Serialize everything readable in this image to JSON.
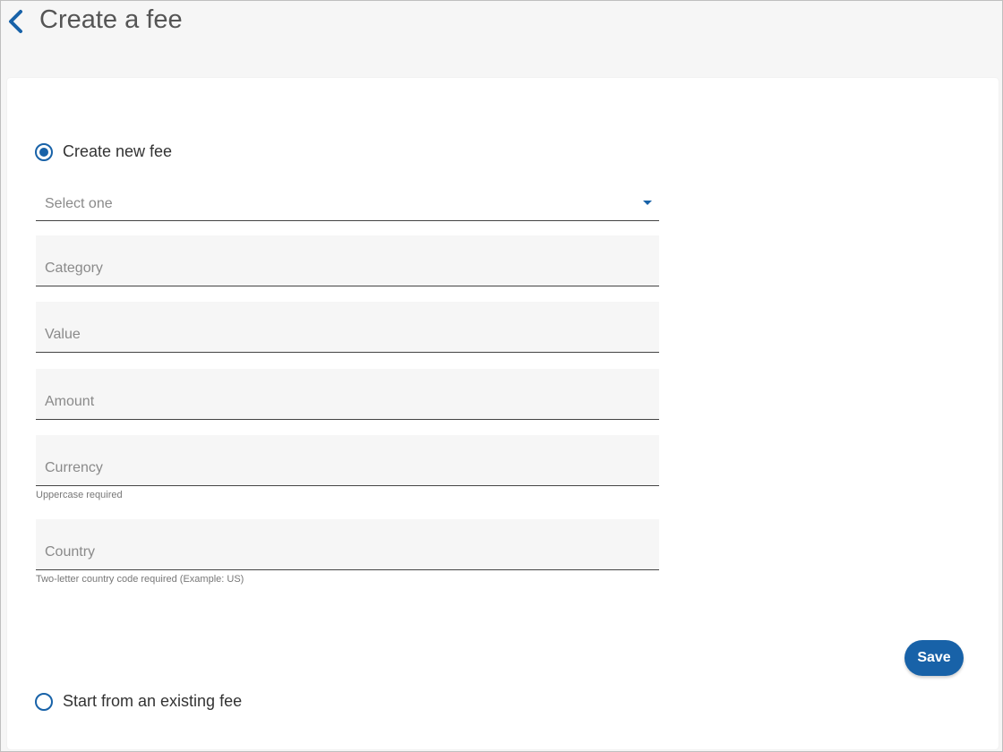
{
  "header": {
    "title": "Create a fee",
    "back_icon": "chevron-left-icon"
  },
  "form": {
    "option_new": {
      "label": "Create new fee",
      "selected": true
    },
    "select": {
      "placeholder": "Select one"
    },
    "fields": {
      "category": {
        "placeholder": "Category",
        "value": ""
      },
      "value": {
        "placeholder": "Value",
        "value": ""
      },
      "amount": {
        "placeholder": "Amount",
        "value": ""
      },
      "currency": {
        "placeholder": "Currency",
        "value": "",
        "hint": "Uppercase required"
      },
      "country": {
        "placeholder": "Country",
        "value": "",
        "hint": "Two-letter country code required (Example: US)"
      }
    },
    "save_label": "Save",
    "option_existing": {
      "label": "Start from an existing fee",
      "selected": false
    }
  },
  "colors": {
    "accent": "#1862a8",
    "background": "#f6f6f6",
    "card": "#ffffff"
  }
}
